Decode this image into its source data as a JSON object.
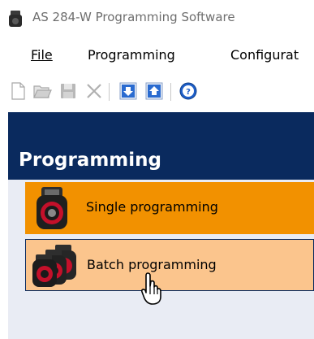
{
  "window": {
    "title": "AS 284-W Programming Software",
    "icon": "app-device-icon"
  },
  "menu": {
    "items": [
      {
        "label": "File"
      },
      {
        "label": "Programming"
      },
      {
        "label": "Configurat"
      }
    ]
  },
  "toolbar": {
    "buttons": [
      {
        "icon": "new-document-icon"
      },
      {
        "icon": "open-folder-icon"
      },
      {
        "icon": "save-icon"
      },
      {
        "icon": "delete-icon"
      },
      {
        "icon": "download-icon"
      },
      {
        "icon": "upload-icon"
      },
      {
        "icon": "help-icon"
      }
    ]
  },
  "panel": {
    "title": "Programming",
    "items": [
      {
        "label": "Single programming",
        "icon": "single-device-icon",
        "state": "selected"
      },
      {
        "label": "Batch programming",
        "icon": "multiple-devices-icon",
        "state": "hover"
      }
    ]
  },
  "colors": {
    "panel_header": "#0a2a5e",
    "selected_item": "#f29100",
    "hover_item": "#fbc58d",
    "panel_bg": "#e9ecf4"
  },
  "cursor": {
    "icon": "hand-pointer-icon"
  }
}
